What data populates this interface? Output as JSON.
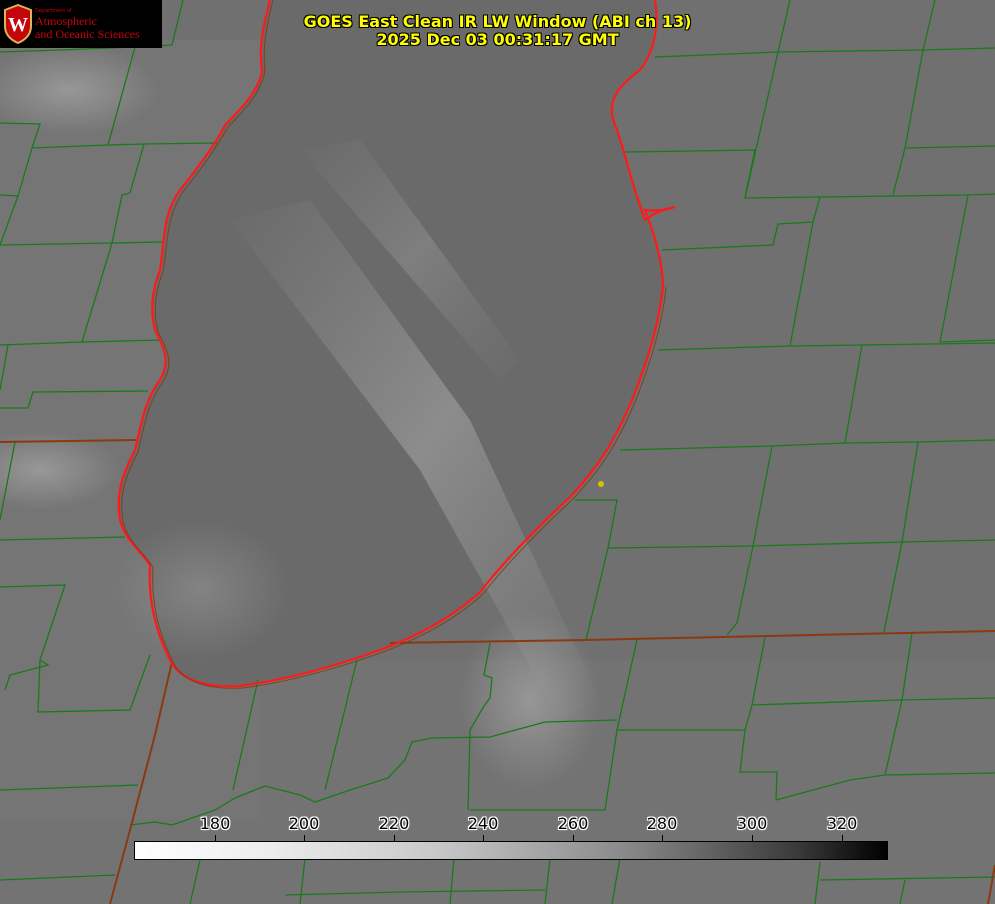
{
  "title": {
    "product": "GOES East Clean IR LW Window (ABI ch 13)",
    "timestamp": "2025 Dec 03 00:31:17 GMT"
  },
  "logo": {
    "dept_small": "Department of",
    "line1": "Atmospheric",
    "line2": "and Oceanic Sciences",
    "seal_letter": "W"
  },
  "colorbar": {
    "ticks": [
      "180",
      "200",
      "220",
      "240",
      "260",
      "280",
      "300",
      "320"
    ],
    "gradient": [
      "#ffffff",
      "#000000"
    ]
  },
  "colors": {
    "county_borders": "#1a7a1a",
    "lake_shoreline": "#ff1a1a",
    "state_borders": "#8a3a10",
    "title_text": "#ffff00",
    "station_dot": "#d8c000",
    "background_gray": "#6f6f6f"
  },
  "map": {
    "features": [
      "lake-michigan-shoreline",
      "county-borders",
      "state-borders",
      "station-marker"
    ]
  }
}
